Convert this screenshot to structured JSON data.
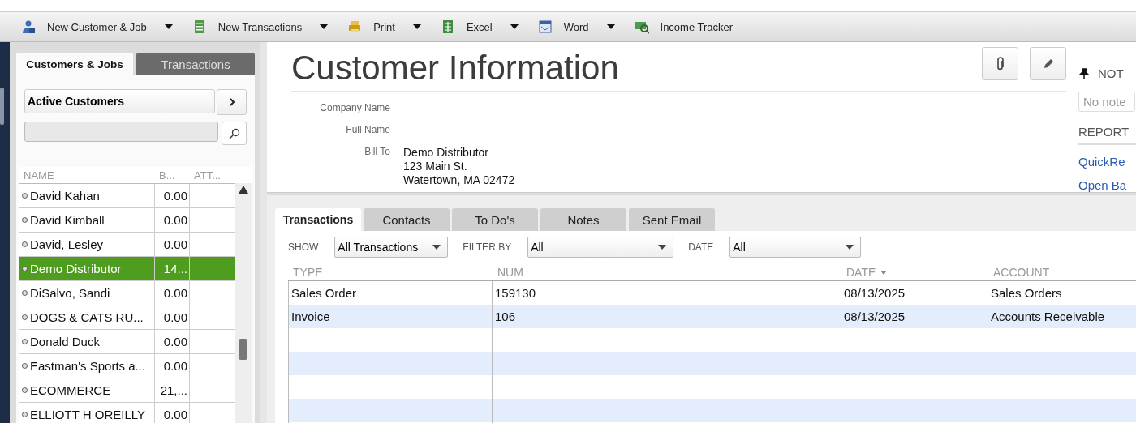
{
  "toolbar": {
    "items": [
      {
        "label": "New Customer & Job",
        "dropdown": true
      },
      {
        "label": "New Transactions",
        "dropdown": true
      },
      {
        "label": "Print",
        "dropdown": true
      },
      {
        "label": "Excel",
        "dropdown": true
      },
      {
        "label": "Word",
        "dropdown": true
      },
      {
        "label": "Income Tracker",
        "dropdown": false
      }
    ]
  },
  "left_panel": {
    "tabs": [
      {
        "label": "Customers & Jobs",
        "selected": true
      },
      {
        "label": "Transactions",
        "selected": false
      }
    ],
    "list_filter": "Active Customers",
    "columns": [
      "NAME",
      "B...",
      "ATT..."
    ],
    "rows": [
      {
        "name": "David Kahan",
        "balance": "0.00",
        "selected": false
      },
      {
        "name": "David Kimball",
        "balance": "0.00",
        "selected": false
      },
      {
        "name": "David, Lesley",
        "balance": "0.00",
        "selected": false
      },
      {
        "name": "Demo Distributor",
        "balance": "14...",
        "selected": true
      },
      {
        "name": "DiSalvo, Sandi",
        "balance": "0.00",
        "selected": false
      },
      {
        "name": "DOGS & CATS RU...",
        "balance": "0.00",
        "selected": false
      },
      {
        "name": "Donald Duck",
        "balance": "0.00",
        "selected": false
      },
      {
        "name": "Eastman's Sports a...",
        "balance": "0.00",
        "selected": false
      },
      {
        "name": "ECOMMERCE",
        "balance": "21,...",
        "selected": false
      },
      {
        "name": "ELLIOTT H OREILLY",
        "balance": "0.00",
        "selected": false
      }
    ]
  },
  "customer_info": {
    "title": "Customer Information",
    "fields": [
      {
        "label": "Company Name"
      },
      {
        "label": "Full Name"
      },
      {
        "label": "Bill To",
        "lines": [
          "Demo Distributor",
          "123 Main St.",
          "Watertown, MA  02472"
        ]
      }
    ]
  },
  "side_panel": {
    "notes_heading": "NOT",
    "notes_placeholder": "No note",
    "reports_heading": "REPORT",
    "links": [
      "QuickRe",
      "Open Ba"
    ]
  },
  "tabs": [
    {
      "label": "Transactions",
      "selected": true
    },
    {
      "label": "Contacts",
      "selected": false
    },
    {
      "label": "To Do's",
      "selected": false
    },
    {
      "label": "Notes",
      "selected": false
    },
    {
      "label": "Sent Email",
      "selected": false
    }
  ],
  "filters": [
    {
      "label": "SHOW",
      "value": "All Transactions"
    },
    {
      "label": "FILTER BY",
      "value": "All"
    },
    {
      "label": "DATE",
      "value": "All"
    }
  ],
  "table": {
    "columns": [
      {
        "label": "TYPE",
        "sorted": false
      },
      {
        "label": "NUM",
        "sorted": false
      },
      {
        "label": "DATE",
        "sorted": true
      },
      {
        "label": "ACCOUNT",
        "sorted": false
      }
    ],
    "rows": [
      {
        "type": "Sales Order",
        "num": "159130",
        "date": "08/13/2025",
        "account": "Sales Orders"
      },
      {
        "type": "Invoice",
        "num": "106",
        "date": "08/13/2025",
        "account": "Accounts Receivable"
      }
    ]
  }
}
